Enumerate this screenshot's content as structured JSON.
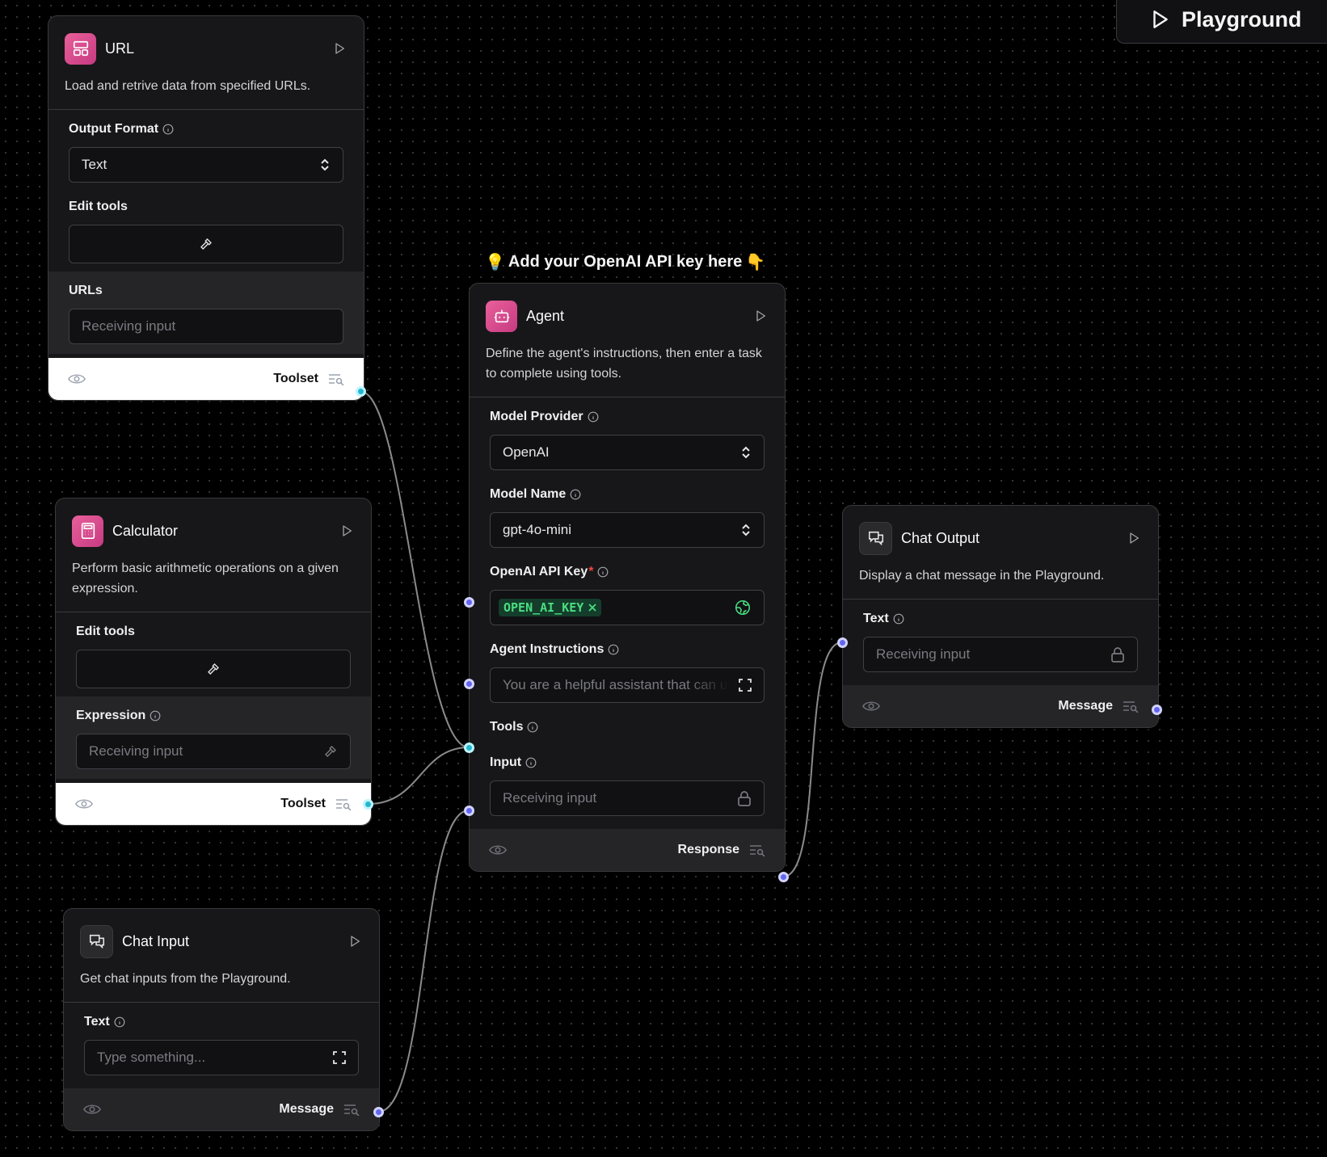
{
  "playground": {
    "label": "Playground"
  },
  "callout": {
    "text": "Add your OpenAI API key here",
    "emoji_left": "💡",
    "emoji_right": "👇"
  },
  "url_node": {
    "title": "URL",
    "description": "Load and retrive data from specified URLs.",
    "output_format": {
      "label": "Output Format",
      "value": "Text"
    },
    "edit_tools": {
      "label": "Edit tools"
    },
    "urls": {
      "label": "URLs",
      "placeholder": "Receiving input"
    },
    "footer": {
      "label": "Toolset"
    }
  },
  "calculator_node": {
    "title": "Calculator",
    "description": "Perform basic arithmetic operations on a given expression.",
    "edit_tools": {
      "label": "Edit tools"
    },
    "expression": {
      "label": "Expression",
      "placeholder": "Receiving input"
    },
    "footer": {
      "label": "Toolset"
    }
  },
  "chat_input_node": {
    "title": "Chat Input",
    "description": "Get chat inputs from the Playground.",
    "text": {
      "label": "Text",
      "placeholder": "Type something..."
    },
    "footer": {
      "label": "Message"
    }
  },
  "agent_node": {
    "title": "Agent",
    "description": "Define the agent's instructions, then enter a task to complete using tools.",
    "model_provider": {
      "label": "Model Provider",
      "value": "OpenAI"
    },
    "model_name": {
      "label": "Model Name",
      "value": "gpt-4o-mini"
    },
    "api_key": {
      "label": "OpenAI API Key",
      "required_mark": "*",
      "value": "OPEN_AI_KEY"
    },
    "instructions": {
      "label": "Agent Instructions",
      "value": "You are a helpful assistant that can use tools to answer questions and perform tasks."
    },
    "tools": {
      "label": "Tools"
    },
    "input": {
      "label": "Input",
      "placeholder": "Receiving input"
    },
    "footer": {
      "label": "Response"
    }
  },
  "chat_output_node": {
    "title": "Chat Output",
    "description": "Display a chat message in the Playground.",
    "text": {
      "label": "Text",
      "placeholder": "Receiving input"
    },
    "footer": {
      "label": "Message"
    }
  },
  "colors": {
    "handle_indigo": "#6366f1",
    "handle_cyan": "#22b8cf",
    "node_icon_pink": "#e8609a",
    "api_key_badge": "#4ade80",
    "edge": "#8a8a8a"
  }
}
